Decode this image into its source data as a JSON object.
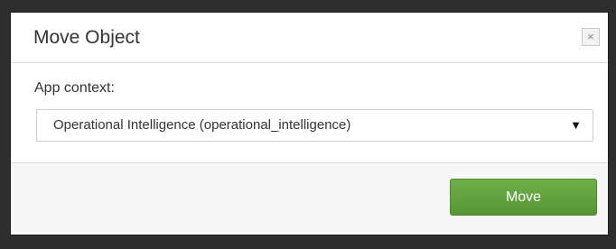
{
  "dialog": {
    "title": "Move Object",
    "close_icon_glyph": "×",
    "close_icon_name": "close-icon"
  },
  "form": {
    "app_context_label": "App context:",
    "app_context_value": "Operational Intelligence (operational_intelligence)",
    "dropdown_icon_glyph": "▼",
    "dropdown_icon_name": "triangle-down-icon"
  },
  "footer": {
    "move_label": "Move"
  },
  "colors": {
    "accent_button": "#5fa33f",
    "backdrop": "#2e2e2e"
  }
}
